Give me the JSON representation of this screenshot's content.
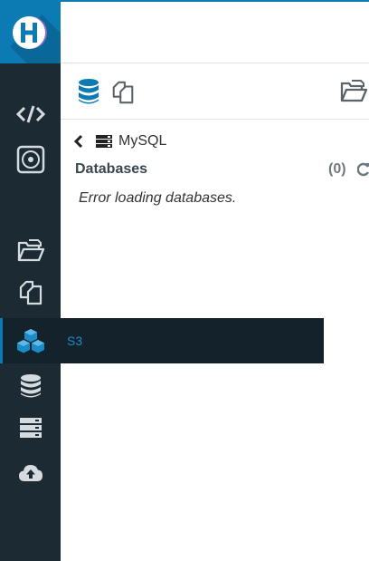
{
  "sidebar": {
    "logo": "hue-logo",
    "items": [
      {
        "name": "editor",
        "icon": "code-icon"
      },
      {
        "name": "scheduler",
        "icon": "target-icon"
      },
      {
        "name": "files",
        "icon": "folder-open-icon"
      },
      {
        "name": "documents",
        "icon": "documents-icon"
      },
      {
        "name": "s3",
        "icon": "cubes-icon",
        "active": true
      },
      {
        "name": "databases",
        "icon": "database-icon"
      },
      {
        "name": "servers",
        "icon": "server-icon"
      },
      {
        "name": "upload",
        "icon": "cloud-upload-icon"
      }
    ],
    "tooltip": "S3"
  },
  "assist": {
    "tabs": [
      {
        "icon": "database-icon",
        "active": true
      },
      {
        "icon": "documents-icon",
        "active": false
      }
    ],
    "right_icon": "folder-open-icon"
  },
  "panel": {
    "breadcrumb": "MySQL",
    "section_title": "Databases",
    "count": "(0)",
    "error": "Error loading databases."
  },
  "colors": {
    "sidebar_bg": "#1b2a33",
    "accent": "#0c7bb3",
    "icon_light": "#c9d0d4"
  }
}
